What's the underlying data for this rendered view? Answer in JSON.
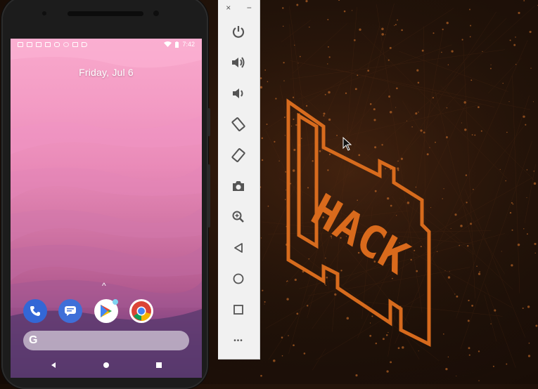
{
  "phone": {
    "date_text": "Friday, Jul 6",
    "status_time": "7:42",
    "status_icons_left": [
      "mail-icon",
      "person-icon",
      "image-icon",
      "gmail-icon",
      "twitter-icon",
      "circle-icon",
      "sd-card-icon",
      "play-store-icon"
    ],
    "status_icons_right": [
      "wifi-icon",
      "battery-icon"
    ],
    "swipe_indicator": "^",
    "dock_apps": [
      {
        "name": "phone-app-icon",
        "color": "#3367d6"
      },
      {
        "name": "messages-app-icon",
        "color": "#3f6fd8"
      },
      {
        "name": "play-store-app-icon",
        "color": "#ffffff"
      },
      {
        "name": "chrome-app-icon",
        "color": "#ffffff"
      }
    ],
    "search_logo": "G",
    "nav_buttons": [
      "back-icon",
      "home-icon",
      "overview-icon"
    ]
  },
  "toolbar": {
    "close_label": "×",
    "minimize_label": "−",
    "buttons": [
      "power-icon",
      "volume-up-icon",
      "volume-down-icon",
      "rotate-left-icon",
      "rotate-right-icon",
      "camera-icon",
      "zoom-icon",
      "back-icon",
      "home-icon",
      "overview-icon",
      "more-icon"
    ],
    "more_label": "•••"
  },
  "desktop": {
    "wallpaper_text": "HACK",
    "accent_color": "#e0701f"
  }
}
